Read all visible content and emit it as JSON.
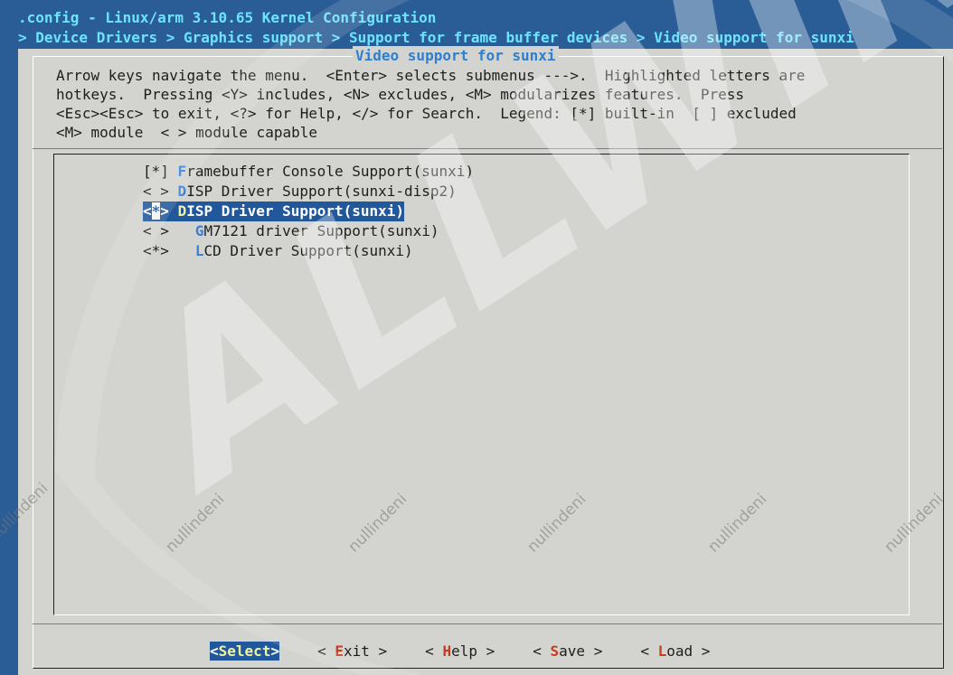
{
  "window": {
    "title": ".config - Linux/arm 3.10.65 Kernel Configuration",
    "breadcrumb": "> Device Drivers > Graphics support > Support for frame buffer devices > Video support for sunxi"
  },
  "dialog": {
    "title": "Video support for sunxi",
    "help_lines": [
      "Arrow keys navigate the menu.  <Enter> selects submenus --->.  Highlighted letters are",
      "hotkeys.  Pressing <Y> includes, <N> excludes, <M> modularizes features.  Press",
      "<Esc><Esc> to exit, <?> for Help, </> for Search.  Legend: [*] built-in  [ ] excluded",
      "<M> module  < > module capable"
    ]
  },
  "menu": {
    "items": [
      {
        "mark": "[*]",
        "hotkey": "F",
        "rest": "ramebuffer Console Support(sunxi)",
        "indent": " "
      },
      {
        "mark": "< >",
        "hotkey": "D",
        "rest": "ISP Driver Support(sunxi-disp2)",
        "indent": " "
      },
      {
        "mark": "<*>",
        "hotkey": "D",
        "rest": "ISP Driver Support(sunxi)",
        "indent": " ",
        "selected": true
      },
      {
        "mark": "< >",
        "hotkey": "G",
        "rest": "M7121 driver Support(sunxi)",
        "indent": "   "
      },
      {
        "mark": "<*>",
        "hotkey": "L",
        "rest": "CD Driver Support(sunxi)",
        "indent": "   "
      }
    ]
  },
  "buttons": [
    {
      "open": "<",
      "hotkey": "S",
      "rest": "elect",
      "close": ">",
      "active": true
    },
    {
      "open": "< ",
      "hotkey": "E",
      "rest": "xit",
      "close": " >"
    },
    {
      "open": "< ",
      "hotkey": "H",
      "rest": "elp",
      "close": " >"
    },
    {
      "open": "< ",
      "hotkey": "S",
      "rest": "ave",
      "close": " >"
    },
    {
      "open": "< ",
      "hotkey": "L",
      "rest": "oad",
      "close": " >"
    }
  ],
  "watermark": {
    "logo_text": "ALLWINNER",
    "repeat_text": "nullindeni"
  },
  "colors": {
    "background": "#2a5d96",
    "dialog": "#d3d3cf",
    "selection": "#21589c",
    "hotkey_menu": "#3a7fd8",
    "hotkey_button": "#c83a20"
  }
}
